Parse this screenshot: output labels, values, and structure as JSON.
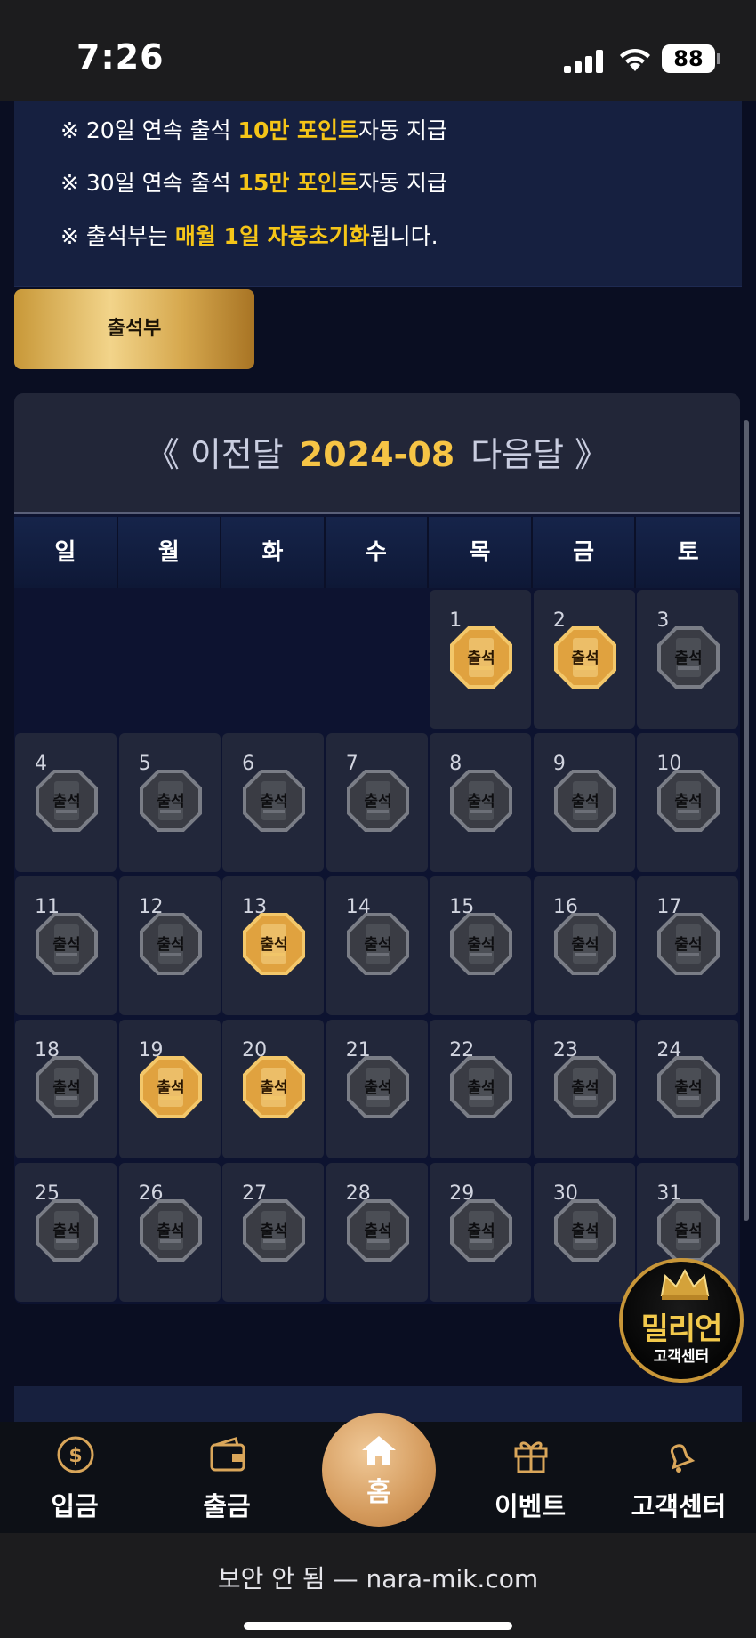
{
  "status_bar": {
    "time": "7:26",
    "battery": "88"
  },
  "notice": {
    "lines": [
      {
        "prefix": "※ 20일 연속 출석 ",
        "highlight": "10만 포인트",
        "suffix": "자동 지급"
      },
      {
        "prefix": "※ 30일 연속 출석 ",
        "highlight": "15만 포인트",
        "suffix": "자동 지급"
      },
      {
        "prefix": "※ 출석부는 ",
        "highlight": "매월 1일 자동초기화",
        "suffix": "됩니다."
      }
    ]
  },
  "tab": {
    "label": "출석부"
  },
  "calendar": {
    "prev_label": "《 이전달",
    "month": "2024-08",
    "next_label": "다음달 》",
    "weekdays": [
      "일",
      "월",
      "화",
      "수",
      "목",
      "금",
      "토"
    ],
    "first_weekday_index": 4,
    "badge_text": "출석",
    "days": [
      {
        "day": "1",
        "checked": true
      },
      {
        "day": "2",
        "checked": true
      },
      {
        "day": "3",
        "checked": false
      },
      {
        "day": "4",
        "checked": false
      },
      {
        "day": "5",
        "checked": false
      },
      {
        "day": "6",
        "checked": false
      },
      {
        "day": "7",
        "checked": false
      },
      {
        "day": "8",
        "checked": false
      },
      {
        "day": "9",
        "checked": false
      },
      {
        "day": "10",
        "checked": false
      },
      {
        "day": "11",
        "checked": false
      },
      {
        "day": "12",
        "checked": false
      },
      {
        "day": "13",
        "checked": true
      },
      {
        "day": "14",
        "checked": false
      },
      {
        "day": "15",
        "checked": false
      },
      {
        "day": "16",
        "checked": false
      },
      {
        "day": "17",
        "checked": false
      },
      {
        "day": "18",
        "checked": false
      },
      {
        "day": "19",
        "checked": true
      },
      {
        "day": "20",
        "checked": true
      },
      {
        "day": "21",
        "checked": false
      },
      {
        "day": "22",
        "checked": false
      },
      {
        "day": "23",
        "checked": false
      },
      {
        "day": "24",
        "checked": false
      },
      {
        "day": "25",
        "checked": false
      },
      {
        "day": "26",
        "checked": false
      },
      {
        "day": "27",
        "checked": false
      },
      {
        "day": "28",
        "checked": false
      },
      {
        "day": "29",
        "checked": false
      },
      {
        "day": "30",
        "checked": false
      },
      {
        "day": "31",
        "checked": false
      }
    ]
  },
  "floating_service": {
    "brand": "밀리언",
    "subtitle": "고객센터",
    "icon": "crown-icon"
  },
  "bottom_nav": {
    "items": [
      {
        "label": "입금",
        "icon": "dollar-coin-icon"
      },
      {
        "label": "출금",
        "icon": "wallet-icon"
      },
      {
        "label": "홈",
        "icon": "home-icon"
      },
      {
        "label": "이벤트",
        "icon": "gift-icon"
      },
      {
        "label": "고객센터",
        "icon": "bell-icon"
      }
    ]
  },
  "browser": {
    "url_text": "보안 안 됨 — nara-mik.com"
  },
  "colors": {
    "accent_gold": "#f5c518",
    "panel": "#162040",
    "cell": "#22273a"
  }
}
